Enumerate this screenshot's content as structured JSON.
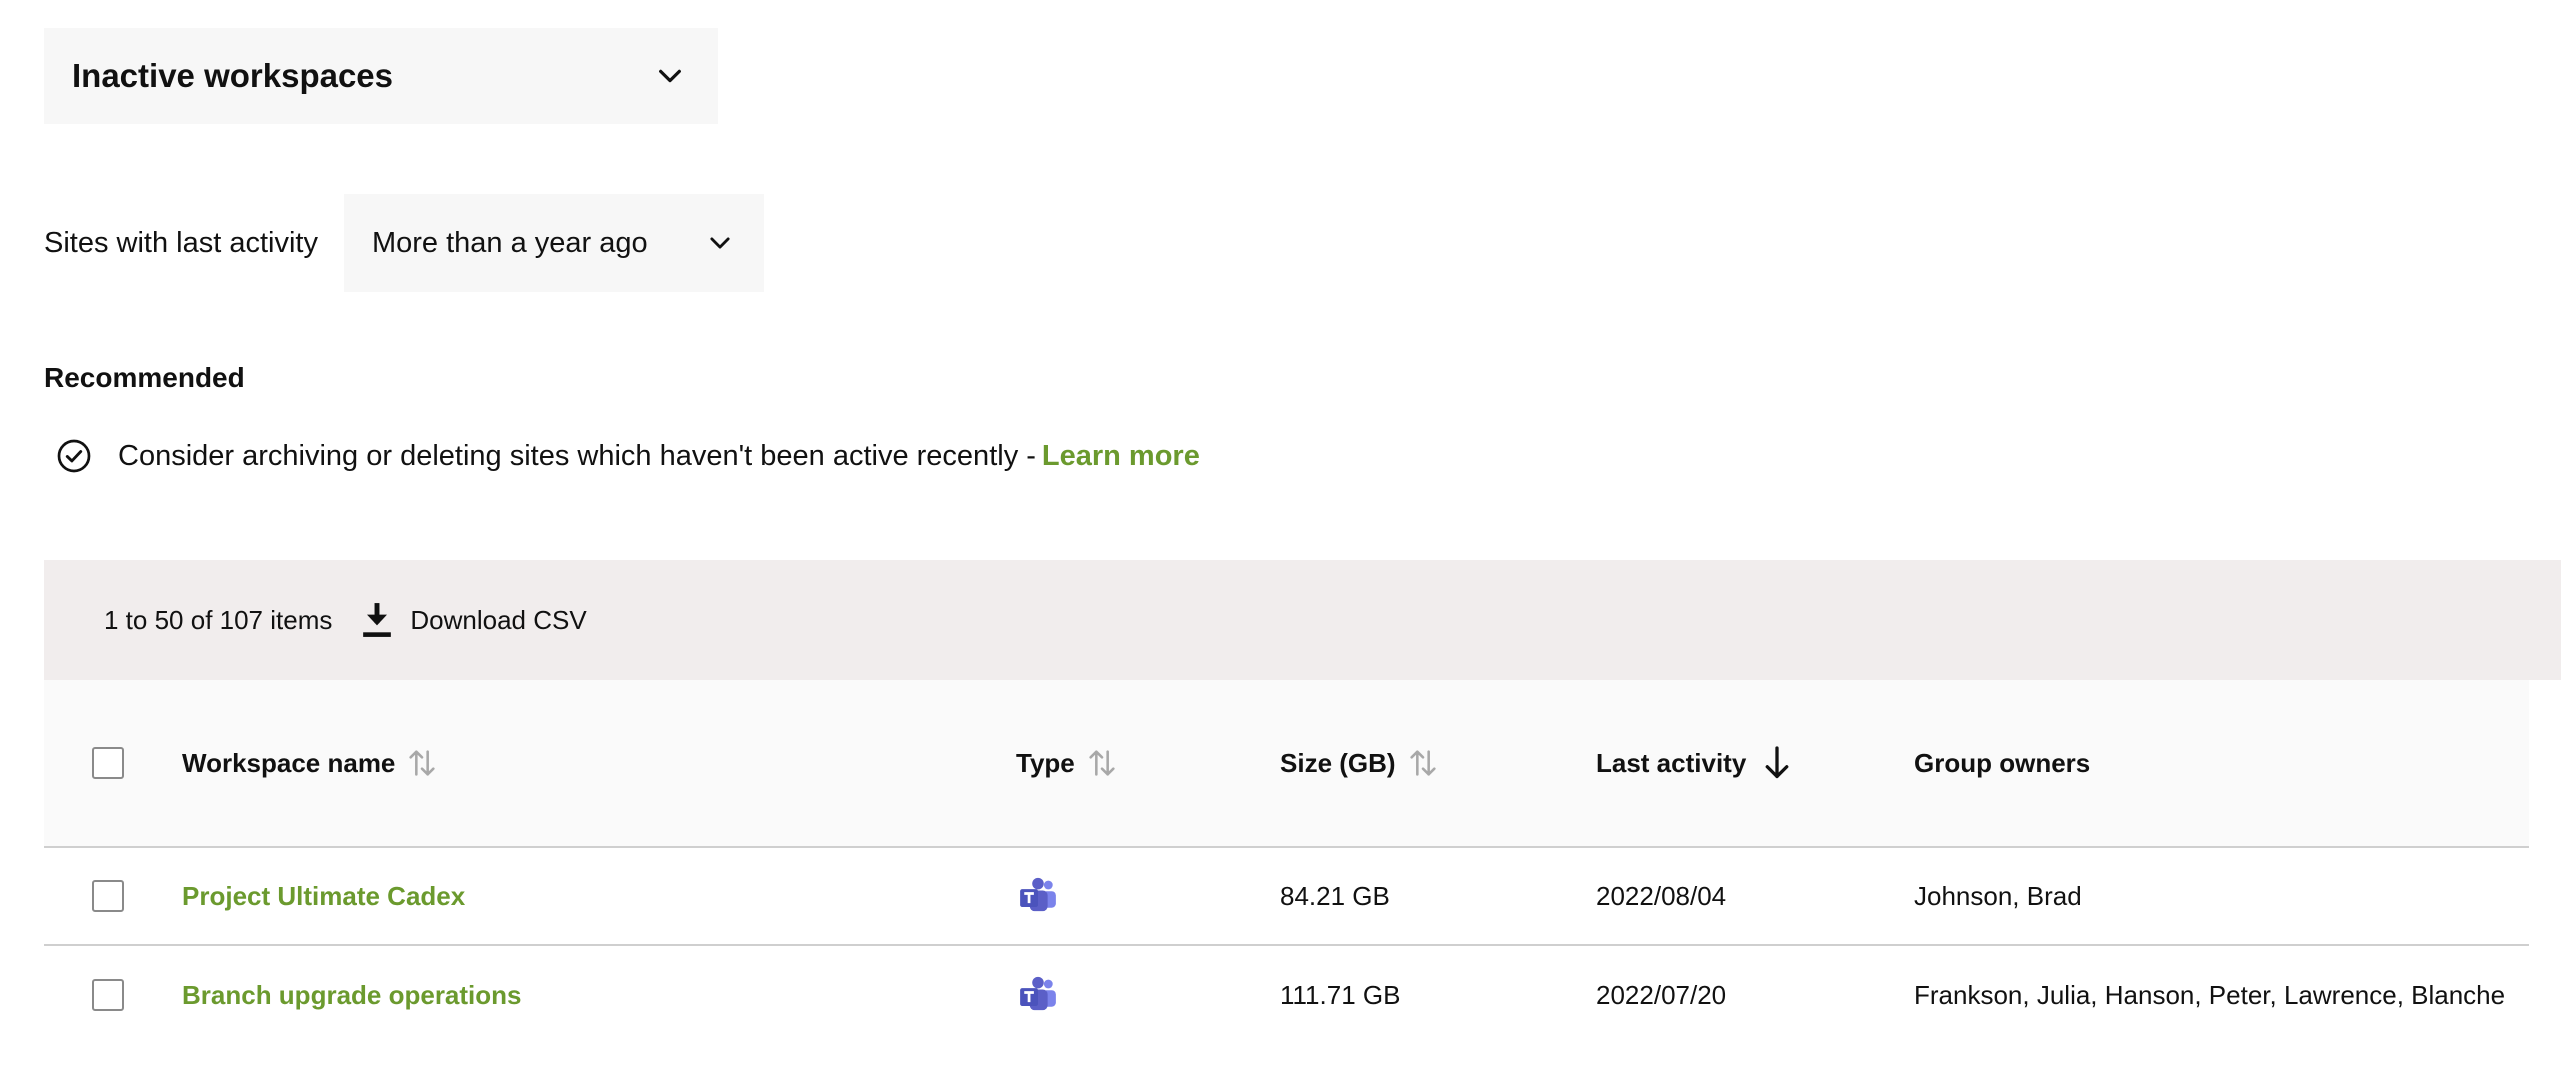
{
  "workspace_filter": {
    "selected": "Inactive workspaces",
    "icon": "chevron-down-icon"
  },
  "activity_filter": {
    "label": "Sites with last activity",
    "selected": "More than a year ago",
    "icon": "chevron-down-icon"
  },
  "recommended": {
    "title": "Recommended",
    "message": "Consider archiving or deleting sites which haven't been active recently -",
    "link": "Learn more",
    "icon": "check-circle-icon"
  },
  "toolbar": {
    "count": "1 to 50 of 107 items",
    "download_label": "Download CSV",
    "download_icon": "download-icon"
  },
  "table": {
    "columns": {
      "name": "Workspace name",
      "type": "Type",
      "size": "Size (GB)",
      "last_activity": "Last activity",
      "owners": "Group owners"
    },
    "sort": {
      "column": "last_activity",
      "direction": "descending"
    },
    "rows": [
      {
        "name": "Project Ultimate Cadex",
        "type": "teams-icon",
        "size": "84.21 GB",
        "last_activity": "2022/08/04",
        "owners": "Johnson, Brad"
      },
      {
        "name": "Branch upgrade operations",
        "type": "teams-icon",
        "size": "111.71 GB",
        "last_activity": "2022/07/20",
        "owners": "Frankson, Julia, Hanson, Peter, Lawrence, Blanche"
      }
    ]
  },
  "colors": {
    "accent_link": "#6b9a2e",
    "toolbar_bg": "#f1eded",
    "dropdown_bg": "#f7f7f7",
    "teams_purple": "#5b5fc7"
  }
}
